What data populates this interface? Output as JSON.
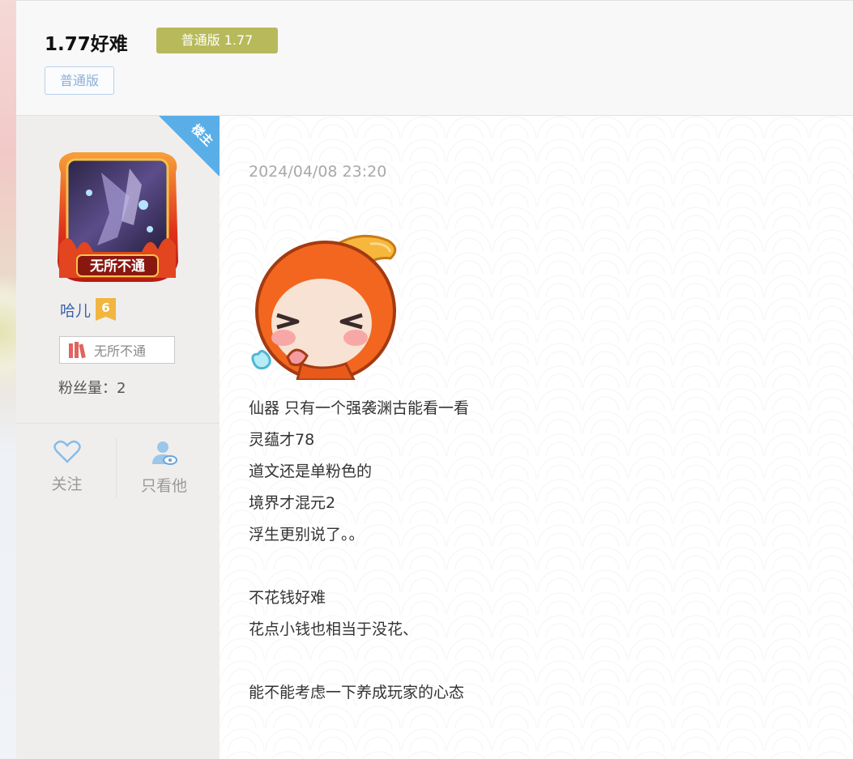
{
  "header": {
    "title": "1.77好难",
    "version_badge": "普通版 1.77",
    "tag": "普通版"
  },
  "author": {
    "owner_ribbon": "楼主",
    "avatar_caption": "无所不通",
    "name": "哈儿",
    "level": "6",
    "title_badge": "无所不通",
    "fans_label": "粉丝量：",
    "fans_count": "2"
  },
  "actions": {
    "follow": "关注",
    "only_him": "只看他"
  },
  "post": {
    "timestamp": "2024/04/08 23:20",
    "lines": [
      "仙器 只有一个强袭渊古能看一看",
      "灵蕴才78",
      "道文还是单粉色的",
      "境界才混元2",
      "浮生更别说了。。",
      "",
      "不花钱好难",
      "花点小钱也相当于没花、",
      "",
      "能不能考虑一下养成玩家的心态"
    ]
  },
  "colors": {
    "accent_link": "#3b63a8",
    "version_badge": "#b8b95a",
    "owner_ribbon": "#5aaee8",
    "level_badge": "#f0b640"
  }
}
